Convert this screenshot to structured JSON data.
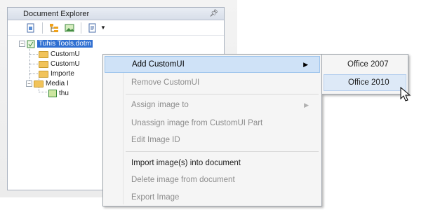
{
  "explorer": {
    "title": "Document Explorer",
    "pin_icon": "pin-icon",
    "toolbar": {
      "buttons": [
        "open-document-icon",
        "customui-tree-icon",
        "insert-image-icon",
        "generate-callbacks-icon"
      ]
    }
  },
  "tree": {
    "root": "Tuhis Tools.dotm",
    "items": [
      "CustomU",
      "CustomU",
      "Importe",
      "Media I",
      "thu"
    ]
  },
  "context_menu": {
    "items": [
      {
        "label": "Add CustomUI",
        "enabled": true,
        "submenu": true,
        "active": true
      },
      {
        "label": "Remove CustomUI",
        "enabled": false
      },
      {
        "label": "Assign image to",
        "enabled": false,
        "submenu": true
      },
      {
        "label": "Unassign image from CustomUI Part",
        "enabled": false
      },
      {
        "label": "Edit Image ID",
        "enabled": false
      },
      {
        "label": "Import image(s) into document",
        "enabled": true
      },
      {
        "label": "Delete image from document",
        "enabled": false
      },
      {
        "label": "Export Image",
        "enabled": false
      }
    ]
  },
  "submenu": {
    "items": [
      "Office 2007",
      "Office 2010"
    ]
  }
}
